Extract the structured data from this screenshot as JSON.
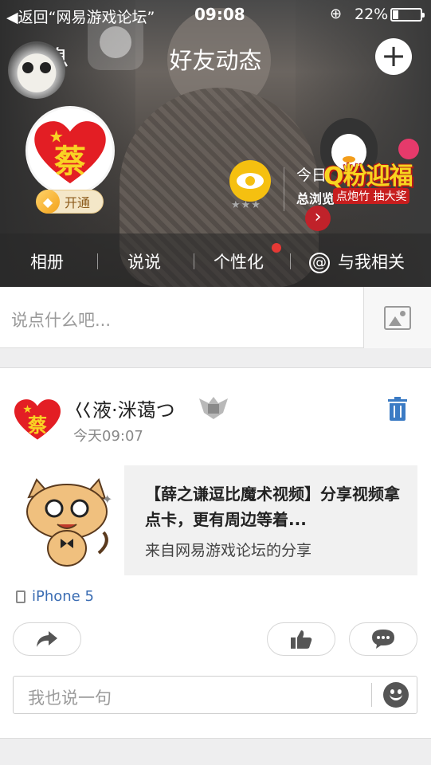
{
  "status_bar": {
    "back_label": "◀返回“网易游戏论坛”",
    "time": "09:08",
    "battery_percent": "22%",
    "battery_level": 0.22
  },
  "nav": {
    "back_label": "消息",
    "title": "好友动态",
    "add_label": "+"
  },
  "profile": {
    "avatar_char": "蔡",
    "vip_label": "开通",
    "visitor_stars": "★★★",
    "today_label": "今日",
    "total_label": "总浏览",
    "promo_title": "Q粉迎福",
    "promo_sub": "点炮竹 抽大奖"
  },
  "tabs": [
    {
      "label": "相册"
    },
    {
      "label": "说说"
    },
    {
      "label": "个性化"
    },
    {
      "label": "与我相关"
    }
  ],
  "compose": {
    "placeholder": "说点什么吧..."
  },
  "post": {
    "author": "巜液·洣蔼つ",
    "avatar_char": "蔡",
    "time": "今天09:07",
    "share_title": "【薛之谦逗比魔术视频】分享视频拿点卡，更有周边等着...",
    "share_source": "来自网易游戏论坛的分享",
    "device": "iPhone 5",
    "comment_placeholder": "我也说一句"
  },
  "colors": {
    "accent_blue": "#3b6db3",
    "eye_yellow": "#f5c010",
    "notify_red": "#e53935"
  }
}
